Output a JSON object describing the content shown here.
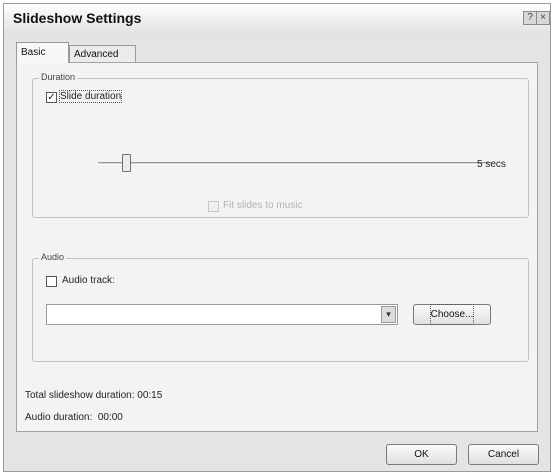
{
  "window": {
    "title": "Slideshow Settings",
    "help_glyph": "?",
    "close_glyph": "×"
  },
  "tabs": [
    {
      "label": "Basic",
      "active": true
    },
    {
      "label": "Advanced",
      "active": false
    }
  ],
  "duration_group": {
    "legend": "Duration",
    "slide_duration": {
      "label": "Slide duration",
      "checked": true,
      "check_glyph": "✓"
    },
    "slider": {
      "value_label": "5 secs",
      "value_secs": 5
    },
    "fit_to_music": {
      "label": "Fit slides to music",
      "checked": false,
      "disabled": true
    }
  },
  "audio_group": {
    "legend": "Audio",
    "audio_track": {
      "label": "Audio track:",
      "checked": false
    },
    "track_select": {
      "value": "",
      "arrow_glyph": "▾"
    },
    "choose_label": "Choose..."
  },
  "totals": {
    "slideshow_duration": "Total slideshow duration: 00:15",
    "audio_duration": "Audio duration:  00:00"
  },
  "footer": {
    "ok_label": "OK",
    "cancel_label": "Cancel"
  }
}
